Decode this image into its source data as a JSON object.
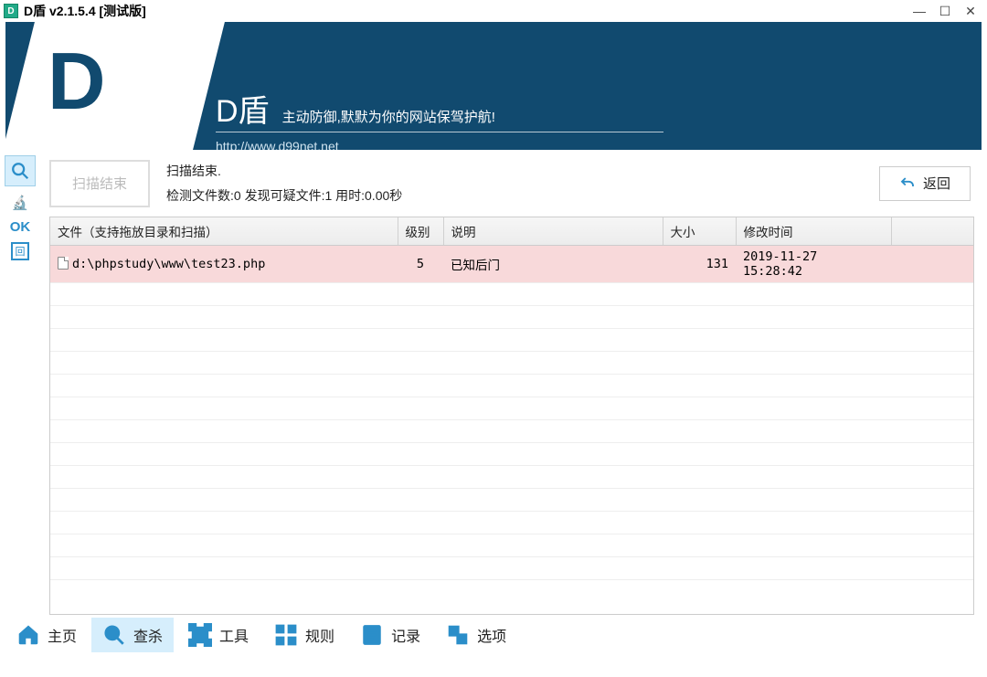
{
  "window": {
    "title": "D盾 v2.1.5.4 [测试版]",
    "app_icon_text": "D"
  },
  "banner": {
    "logo_letter": "D",
    "title": "D盾",
    "tagline": "主动防御,默默为你的网站保驾护航!",
    "url": "http://www.d99net.net"
  },
  "leftbar": {
    "ok_text": "OK"
  },
  "scan": {
    "button_label": "扫描结束",
    "status_line1": "扫描结束.",
    "status_line2": "检测文件数:0 发现可疑文件:1 用时:0.00秒",
    "return_label": "返回"
  },
  "table": {
    "headers": {
      "file": "文件（支持拖放目录和扫描）",
      "level": "级别",
      "desc": "说明",
      "size": "大小",
      "mtime": "修改时间"
    },
    "row1": {
      "file": "d:\\phpstudy\\www\\test23.php",
      "level": "5",
      "desc": "已知后门",
      "size": "131",
      "mtime": "2019-11-27 15:28:42"
    }
  },
  "nav": {
    "home": "主页",
    "scan": "查杀",
    "tools": "工具",
    "rules": "规则",
    "logs": "记录",
    "options": "选项"
  }
}
